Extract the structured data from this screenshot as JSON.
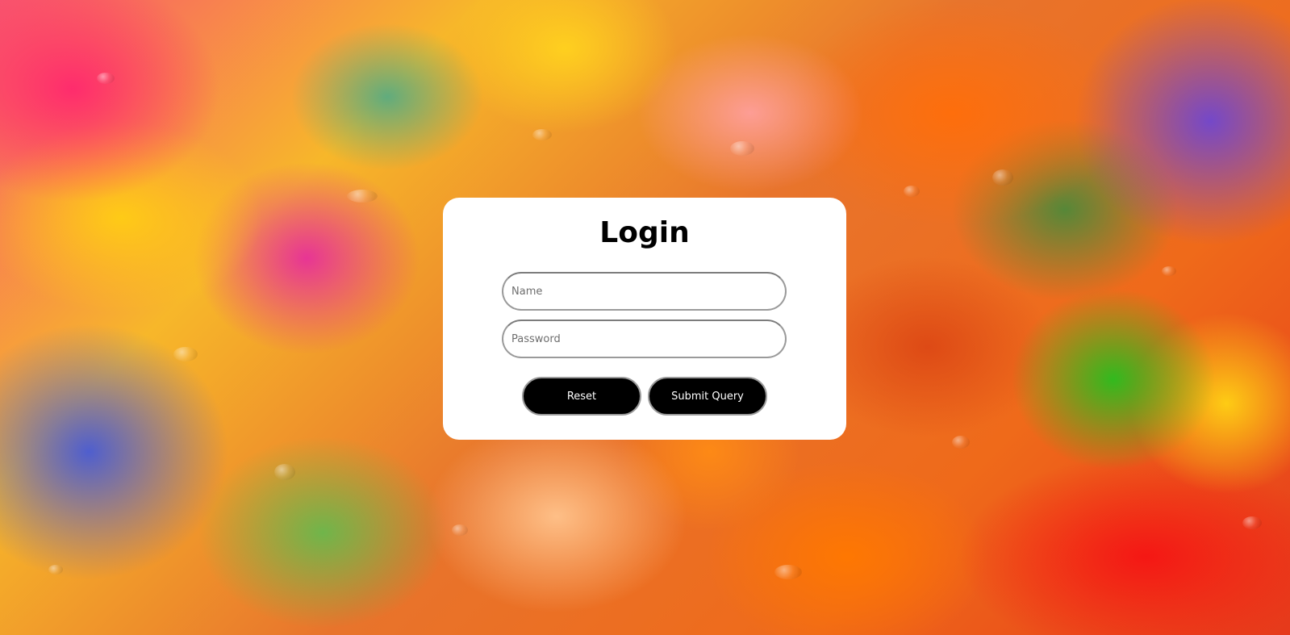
{
  "background": {
    "description_icon": "colorful-abstract-background-image"
  },
  "login_form": {
    "title": "Login",
    "name_placeholder": "Name",
    "name_value": "",
    "password_placeholder": "Password",
    "password_value": "",
    "reset_label": "Reset",
    "submit_label": "Submit Query"
  },
  "colors": {
    "card_background": "#ffffff",
    "button_background": "#000000",
    "button_text": "#ffffff",
    "field_border": "#9a9a9a"
  }
}
